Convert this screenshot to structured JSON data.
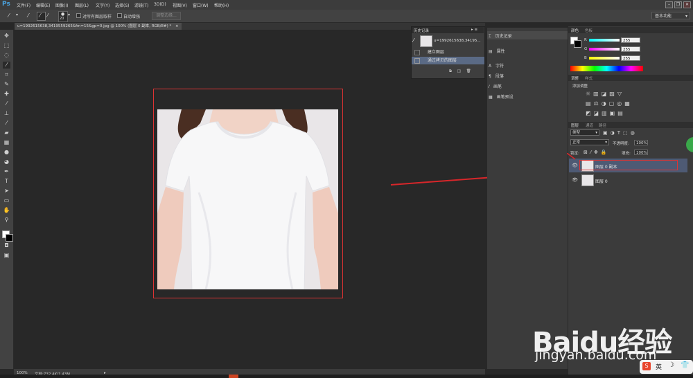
{
  "app": {
    "logo": "Ps"
  },
  "menu": [
    "文件(F)",
    "编辑(E)",
    "图像(I)",
    "图层(L)",
    "文字(Y)",
    "选择(S)",
    "滤镜(T)",
    "3D(D)",
    "视图(V)",
    "窗口(W)",
    "帮助(H)"
  ],
  "options": {
    "brush_size": "20",
    "sample_all_layers": "对所有图层取样",
    "auto_enhance": "自动增强",
    "refine_edge": "调整边缘...",
    "workspace": "基本功能"
  },
  "document": {
    "tab_title": "u=1992615638,3419559265&fm=15&gp=0.jpg @ 100% (图层 0 副本, RGB/8#) *",
    "tab_close": "×"
  },
  "status": {
    "zoom": "100%",
    "doc_info": "文档:732.4K/1.43M"
  },
  "history_panel": {
    "title": "历史记录",
    "snapshot_label": "u=1992615638,34195...",
    "items": [
      "建立图层",
      "通过拷贝的图层"
    ]
  },
  "mid_panels": {
    "history": "历史记录",
    "properties": "属性",
    "character": "字符",
    "paragraph": "段落",
    "brush": "画笔",
    "brush_presets": "画笔预设"
  },
  "color_panel": {
    "tabs": [
      "颜色",
      "色板"
    ],
    "channels": [
      {
        "label": "R",
        "value": "255"
      },
      {
        "label": "G",
        "value": "255"
      },
      {
        "label": "B",
        "value": "255"
      }
    ]
  },
  "adjustments_panel": {
    "tabs": [
      "调整",
      "样式"
    ],
    "subtitle": "添加调整"
  },
  "layers_panel": {
    "tabs": [
      "图层",
      "通道",
      "路径"
    ],
    "filter_label": "类型",
    "blend_mode": "正常",
    "opacity_label": "不透明度:",
    "opacity_value": "100%",
    "lock_label": "锁定:",
    "fill_label": "填充:",
    "fill_value": "100%",
    "layers": [
      {
        "name": "图层 0 副本",
        "selected": true,
        "visible": true
      },
      {
        "name": "图层 0",
        "selected": false,
        "visible": true
      }
    ]
  },
  "watermark": {
    "main": "Baidu经验",
    "url": "jingyan.baidu.com"
  },
  "tray": {
    "input_method": "英",
    "moon": "☽"
  },
  "colors": {
    "annotation_red": "#e02020",
    "selected_layer": "#4e5a74",
    "ps_blue": "#4aa3df"
  }
}
